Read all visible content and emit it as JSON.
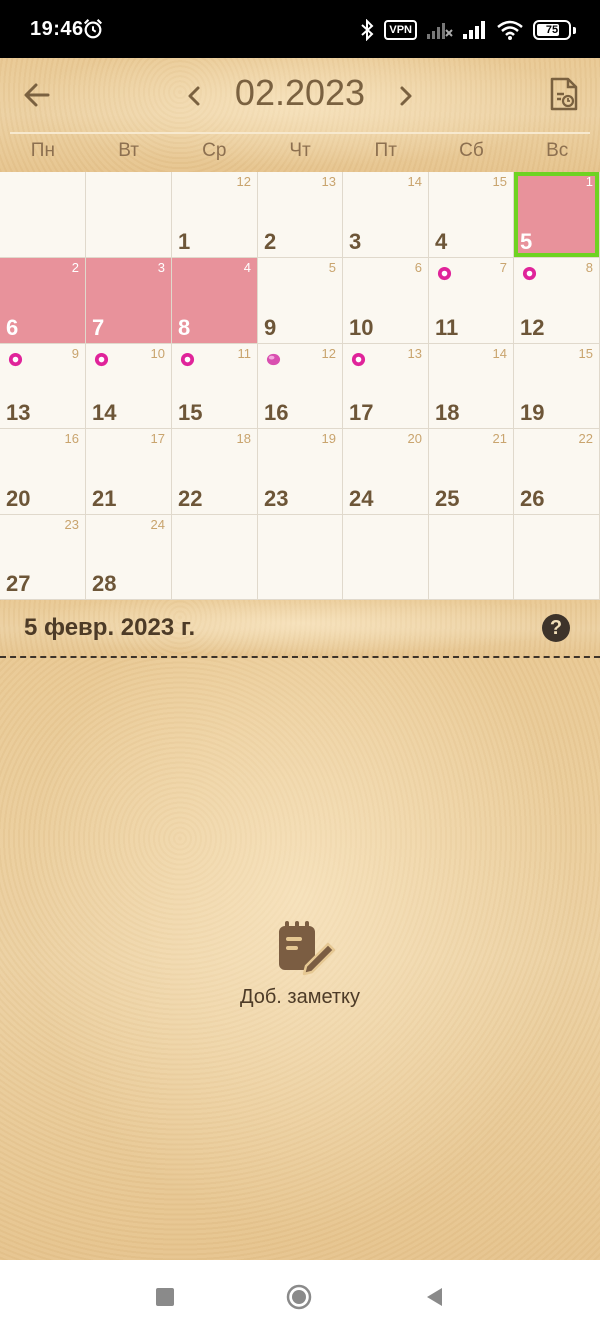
{
  "status_bar": {
    "time": "19:46",
    "vpn": "VPN",
    "battery": "75",
    "icons": [
      "alarm-icon",
      "bluetooth-icon",
      "signal-x-icon",
      "signal-icon",
      "wifi-icon",
      "battery-icon"
    ]
  },
  "header": {
    "month": "02.2023",
    "weekdays": [
      "Пн",
      "Вт",
      "Ср",
      "Чт",
      "Пт",
      "Сб",
      "Вс"
    ],
    "icons": [
      "back-arrow-icon",
      "chevron-left-icon",
      "chevron-right-icon",
      "export-report-icon"
    ]
  },
  "calendar": {
    "days": [
      {
        "day": "",
        "lunar": ""
      },
      {
        "day": "",
        "lunar": ""
      },
      {
        "day": "1",
        "lunar": "12"
      },
      {
        "day": "2",
        "lunar": "13"
      },
      {
        "day": "3",
        "lunar": "14"
      },
      {
        "day": "4",
        "lunar": "15"
      },
      {
        "day": "5",
        "lunar": "1",
        "period": true,
        "selected": true
      },
      {
        "day": "6",
        "lunar": "2",
        "period": true
      },
      {
        "day": "7",
        "lunar": "3",
        "period": true
      },
      {
        "day": "8",
        "lunar": "4",
        "period": true
      },
      {
        "day": "9",
        "lunar": "5"
      },
      {
        "day": "10",
        "lunar": "6"
      },
      {
        "day": "11",
        "lunar": "7",
        "dot": "flower"
      },
      {
        "day": "12",
        "lunar": "8",
        "dot": "flower"
      },
      {
        "day": "13",
        "lunar": "9",
        "dot": "flower"
      },
      {
        "day": "14",
        "lunar": "10",
        "dot": "flower"
      },
      {
        "day": "15",
        "lunar": "11",
        "dot": "flower"
      },
      {
        "day": "16",
        "lunar": "12",
        "dot": "egg"
      },
      {
        "day": "17",
        "lunar": "13",
        "dot": "flower"
      },
      {
        "day": "18",
        "lunar": "14"
      },
      {
        "day": "19",
        "lunar": "15"
      },
      {
        "day": "20",
        "lunar": "16"
      },
      {
        "day": "21",
        "lunar": "17"
      },
      {
        "day": "22",
        "lunar": "18"
      },
      {
        "day": "23",
        "lunar": "19"
      },
      {
        "day": "24",
        "lunar": "20"
      },
      {
        "day": "25",
        "lunar": "21"
      },
      {
        "day": "26",
        "lunar": "22"
      },
      {
        "day": "27",
        "lunar": "23"
      },
      {
        "day": "28",
        "lunar": "24"
      },
      {
        "day": "",
        "lunar": ""
      },
      {
        "day": "",
        "lunar": ""
      },
      {
        "day": "",
        "lunar": ""
      },
      {
        "day": "",
        "lunar": ""
      },
      {
        "day": "",
        "lunar": ""
      }
    ],
    "colors": {
      "period": "#e8929b",
      "selected_border": "#6ed321",
      "fertile_dot": "#e0249a"
    }
  },
  "date_bar": {
    "title": "5 февр. 2023 г.",
    "help": "?"
  },
  "notes": {
    "add_label": "Доб. заметку",
    "icon": "note-edit-icon"
  },
  "nav_bar": {
    "icons": [
      "recents-square-icon",
      "home-circle-icon",
      "back-triangle-icon"
    ]
  }
}
